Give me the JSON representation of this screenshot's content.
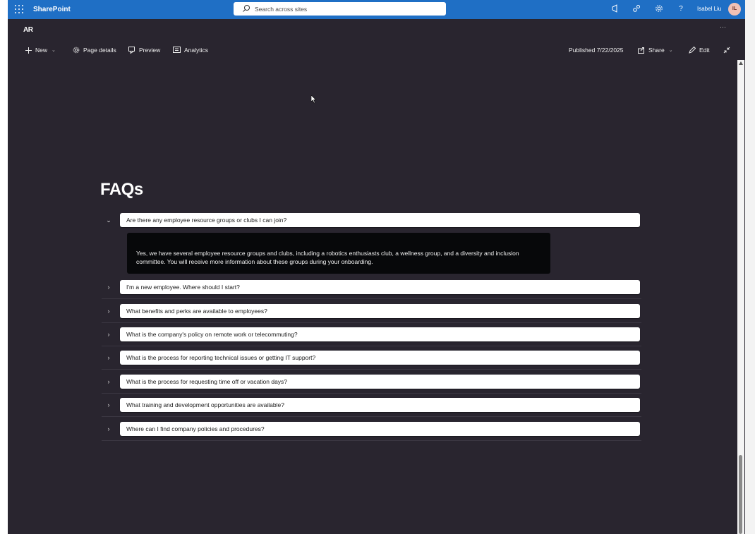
{
  "suitebar": {
    "app_name": "SharePoint",
    "search_placeholder": "Search across sites",
    "user_name": "Isabel Liu",
    "user_initials": "IL"
  },
  "site": {
    "logo": "AR",
    "more": "···"
  },
  "commandbar": {
    "new": "New",
    "page_details": "Page details",
    "preview": "Preview",
    "analytics": "Analytics",
    "published": "Published 7/22/2025",
    "share": "Share",
    "edit": "Edit"
  },
  "faq": {
    "title": "FAQs",
    "expanded_answer": "Yes, we have several employee resource groups and clubs, including a robotics enthusiasts club, a wellness group, and a diversity and inclusion committee. You will receive more information about these groups during your onboarding.",
    "items": [
      {
        "question": "Are there any employee resource groups or clubs I can join?",
        "expanded": true
      },
      {
        "question": "I'm a new employee. Where should I start?",
        "expanded": false
      },
      {
        "question": "What benefits and perks are available to employees?",
        "expanded": false
      },
      {
        "question": "What is the company's policy on remote work or telecommuting?",
        "expanded": false
      },
      {
        "question": "What is the process for reporting technical issues or getting IT support?",
        "expanded": false
      },
      {
        "question": "What is the process for requesting time off or vacation days?",
        "expanded": false
      },
      {
        "question": "What training and development opportunities are available?",
        "expanded": false
      },
      {
        "question": "Where can I find company policies and procedures?",
        "expanded": false
      }
    ]
  },
  "colors": {
    "suitebar": "#1f6fc5",
    "page_background": "#29252f",
    "answer_background": "#07080a"
  }
}
